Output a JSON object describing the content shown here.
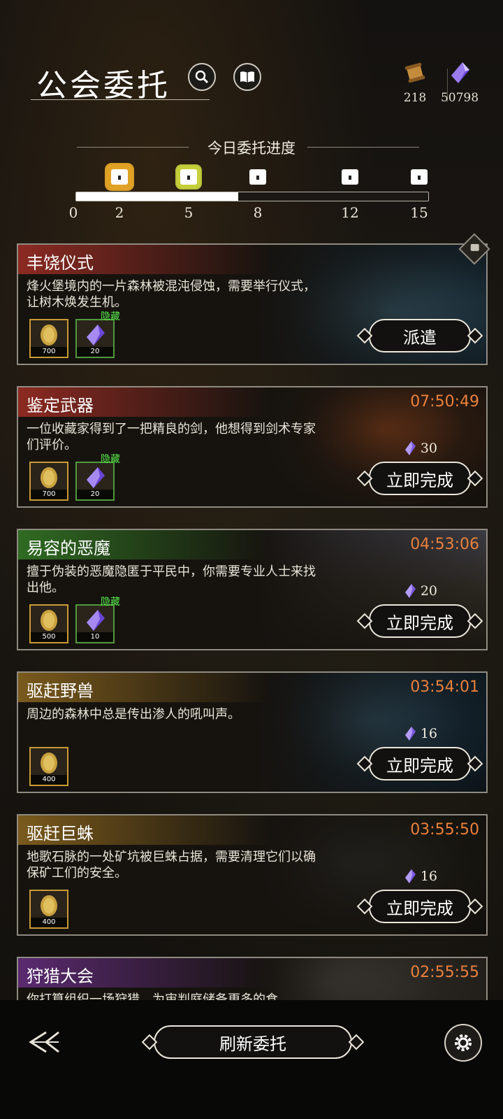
{
  "header": {
    "title": "公会委托",
    "icons": [
      "search-icon",
      "book-icon"
    ],
    "resources": [
      {
        "icon": "scroll-icon",
        "value": "218"
      },
      {
        "icon": "crystal-icon",
        "value": "50798"
      }
    ]
  },
  "progress": {
    "label": "今日委托进度",
    "fill_fraction": 0.46,
    "ticks": [
      "0",
      "2",
      "5",
      "8",
      "12",
      "15"
    ],
    "milestones": [
      {
        "value": 2,
        "state": "claimed"
      },
      {
        "value": 5,
        "state": "available"
      },
      {
        "value": 8,
        "state": "locked"
      },
      {
        "value": 12,
        "state": "locked"
      },
      {
        "value": 15,
        "state": "locked"
      }
    ]
  },
  "commissions": [
    {
      "title": "丰饶仪式",
      "header_color": "#8c2a22",
      "description": "烽火堡境内的一片森林被混沌侵蚀，需要举行仪式，让树木焕发生机。",
      "timer": "",
      "cost": "",
      "rewards": [
        {
          "icon": "gold-coin-icon",
          "qty": "700",
          "border": "gold"
        },
        {
          "icon": "crystal-icon",
          "qty": "20",
          "border": "green",
          "tag": "隐藏"
        }
      ],
      "action": "派遣",
      "locked": true
    },
    {
      "title": "鉴定武器",
      "header_color": "#8c2a22",
      "description": "一位收藏家得到了一把精良的剑，他想得到剑术专家们评价。",
      "timer": "07:50:49",
      "cost": "30",
      "rewards": [
        {
          "icon": "gold-coin-icon",
          "qty": "700",
          "border": "gold"
        },
        {
          "icon": "crystal-icon",
          "qty": "20",
          "border": "green",
          "tag": "隐藏"
        }
      ],
      "action": "立即完成"
    },
    {
      "title": "易容的恶魔",
      "header_color": "#2f6b22",
      "description": "擅于伪装的恶魔隐匿于平民中，你需要专业人士来找出他。",
      "timer": "04:53:06",
      "cost": "20",
      "rewards": [
        {
          "icon": "gold-coin-icon",
          "qty": "500",
          "border": "gold"
        },
        {
          "icon": "crystal-icon",
          "qty": "10",
          "border": "green",
          "tag": "隐藏"
        }
      ],
      "action": "立即完成"
    },
    {
      "title": "驱赶野兽",
      "header_color": "#7a5a1c",
      "description": "周边的森林中总是传出渗人的吼叫声。",
      "timer": "03:54:01",
      "cost": "16",
      "rewards": [
        {
          "icon": "gold-coin-icon",
          "qty": "400",
          "border": "gold"
        }
      ],
      "action": "立即完成"
    },
    {
      "title": "驱赶巨蛛",
      "header_color": "#7a5a1c",
      "description": "地歌石脉的一处矿坑被巨蛛占据，需要清理它们以确保矿工们的安全。",
      "timer": "03:55:50",
      "cost": "16",
      "rewards": [
        {
          "icon": "gold-coin-icon",
          "qty": "400",
          "border": "gold"
        }
      ],
      "action": "立即完成"
    },
    {
      "title": "狩猎大会",
      "header_color": "#5a2a70",
      "description": "你打算组织一场狩猎，为审判庭储备更多的食",
      "timer": "02:55:55",
      "cost": "",
      "rewards": [],
      "action": ""
    }
  ],
  "footer": {
    "refresh_label": "刷新委托",
    "icons": [
      "back-icon",
      "settings-icon"
    ]
  },
  "colors": {
    "accent_orange": "#e9803c",
    "hidden_green": "#57e84a",
    "gold_border": "#c99a33"
  }
}
